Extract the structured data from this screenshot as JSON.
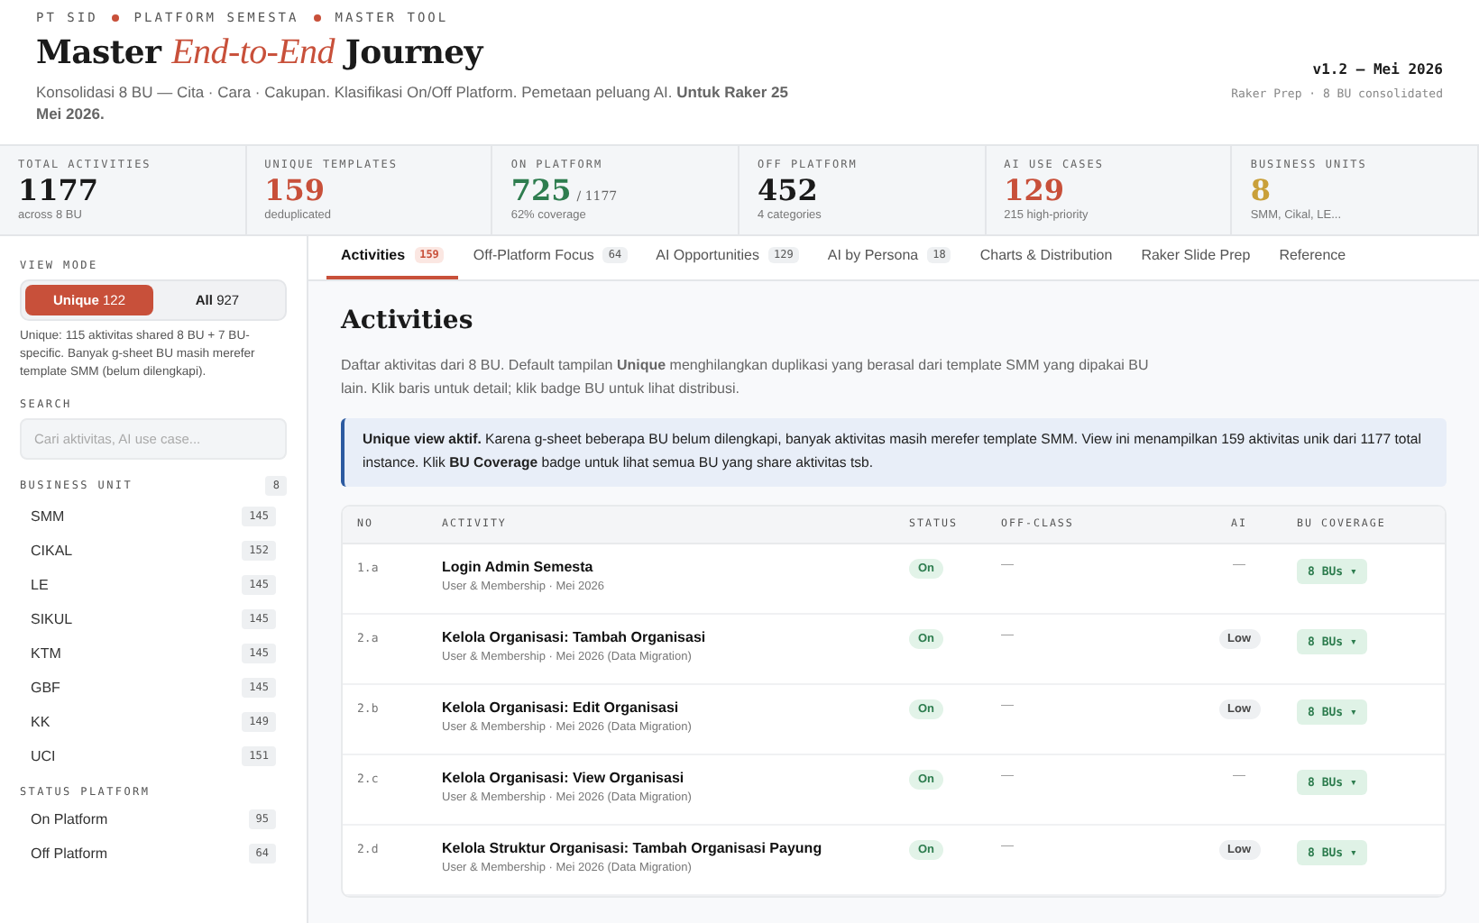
{
  "header": {
    "breadcrumb": [
      "PT SID",
      "PLATFORM SEMESTA",
      "MASTER TOOL"
    ],
    "title": {
      "before": "Master",
      "accent": "End-to-End",
      "after": "Journey"
    },
    "subtitle": "Konsolidasi 8 BU — Cita · Cara · Cakupan. Klasifikasi On/Off Platform. Pemetaan peluang AI. **Untuk Raker 25 Mei 2026.**",
    "version": "v1.2 — Mei 2026",
    "version_note": "Raker Prep · 8 BU consolidated"
  },
  "stats": [
    {
      "label": "TOTAL ACTIVITIES",
      "value": "1177",
      "note": "across 8 BU",
      "color": "#1a1a1a"
    },
    {
      "label": "UNIQUE TEMPLATES",
      "value": "159",
      "note": "deduplicated",
      "color": "#c8503a"
    },
    {
      "label": "ON PLATFORM",
      "value": "725",
      "suffix": "/ 1177",
      "note": "62% coverage",
      "color": "#2e7d4f"
    },
    {
      "label": "OFF PLATFORM",
      "value": "452",
      "note": "4 categories",
      "color": "#1a1a1a"
    },
    {
      "label": "AI USE CASES",
      "value": "129",
      "note": "215 high-priority",
      "color": "#c8503a"
    },
    {
      "label": "BUSINESS UNITS",
      "value": "8",
      "note": "SMM, Cikal, LE...",
      "color": "#c9a03a"
    }
  ],
  "sidebar": {
    "view_mode": {
      "label": "VIEW MODE",
      "options": [
        {
          "label": "Unique",
          "count": "122",
          "selected": true
        },
        {
          "label": "All",
          "count": "927",
          "selected": false
        }
      ],
      "note": "Unique: 115 aktivitas shared 8 BU + 7 BU-specific. Banyak g-sheet BU masih merefer template SMM (belum dilengkapi)."
    },
    "search": {
      "label": "SEARCH",
      "placeholder": "Cari aktivitas, AI use case..."
    },
    "business_unit": {
      "label": "BUSINESS UNIT",
      "count": "8",
      "items": [
        {
          "name": "SMM",
          "count": "145"
        },
        {
          "name": "CIKAL",
          "count": "152"
        },
        {
          "name": "LE",
          "count": "145"
        },
        {
          "name": "SIKUL",
          "count": "145"
        },
        {
          "name": "KTM",
          "count": "145"
        },
        {
          "name": "GBF",
          "count": "145"
        },
        {
          "name": "KK",
          "count": "149"
        },
        {
          "name": "UCI",
          "count": "151"
        }
      ]
    },
    "status_platform": {
      "label": "STATUS PLATFORM",
      "items": [
        {
          "name": "On Platform",
          "count": "95"
        },
        {
          "name": "Off Platform",
          "count": "64"
        }
      ]
    }
  },
  "tabs": [
    {
      "label": "Activities",
      "count": "159",
      "selected": true
    },
    {
      "label": "Off-Platform Focus",
      "count": "64",
      "selected": false
    },
    {
      "label": "AI Opportunities",
      "count": "129",
      "selected": false
    },
    {
      "label": "AI by Persona",
      "count": "18",
      "selected": false
    },
    {
      "label": "Charts & Distribution",
      "selected": false
    },
    {
      "label": "Raker Slide Prep",
      "selected": false
    },
    {
      "label": "Reference",
      "selected": false
    }
  ],
  "content": {
    "title": "Activities",
    "intro": "Daftar aktivitas dari 8 BU. Default tampilan **Unique** menghilangkan duplikasi yang berasal dari template SMM yang dipakai BU lain. Klik baris untuk detail; klik badge BU untuk lihat distribusi.",
    "notice": "**Unique view aktif.** Karena g-sheet beberapa BU belum dilengkapi, banyak aktivitas masih merefer template SMM. View ini menampilkan 159 aktivitas unik dari 1177 total instance. Klik **BU Coverage** badge untuk lihat semua BU yang share aktivitas tsb.",
    "table": {
      "columns": [
        "NO",
        "ACTIVITY",
        "STATUS",
        "OFF-CLASS",
        "AI",
        "BU COVERAGE"
      ],
      "rows": [
        {
          "no": "1.a",
          "activity": "Login Admin Semesta",
          "meta": "User & Membership · Mei 2026",
          "status": "On",
          "off_class": "—",
          "ai": {
            "kind": "dash",
            "text": "—"
          },
          "coverage": "8 BUs ▾"
        },
        {
          "no": "2.a",
          "activity": "Kelola Organisasi: Tambah Organisasi",
          "meta": "User & Membership · Mei 2026 (Data Migration)",
          "status": "On",
          "off_class": "—",
          "ai": {
            "kind": "badge",
            "text": "Low"
          },
          "coverage": "8 BUs ▾"
        },
        {
          "no": "2.b",
          "activity": "Kelola Organisasi: Edit Organisasi",
          "meta": "User & Membership · Mei 2026 (Data Migration)",
          "status": "On",
          "off_class": "—",
          "ai": {
            "kind": "badge",
            "text": "Low"
          },
          "coverage": "8 BUs ▾"
        },
        {
          "no": "2.c",
          "activity": "Kelola Organisasi: View Organisasi",
          "meta": "User & Membership · Mei 2026 (Data Migration)",
          "status": "On",
          "off_class": "—",
          "ai": {
            "kind": "dash",
            "text": "—"
          },
          "coverage": "8 BUs ▾"
        },
        {
          "no": "2.d",
          "activity": "Kelola Struktur Organisasi: Tambah Organisasi Payung",
          "meta": "User & Membership · Mei 2026 (Data Migration)",
          "status": "On",
          "off_class": "—",
          "ai": {
            "kind": "badge",
            "text": "Low"
          },
          "coverage": "8 BUs ▾"
        }
      ]
    }
  }
}
